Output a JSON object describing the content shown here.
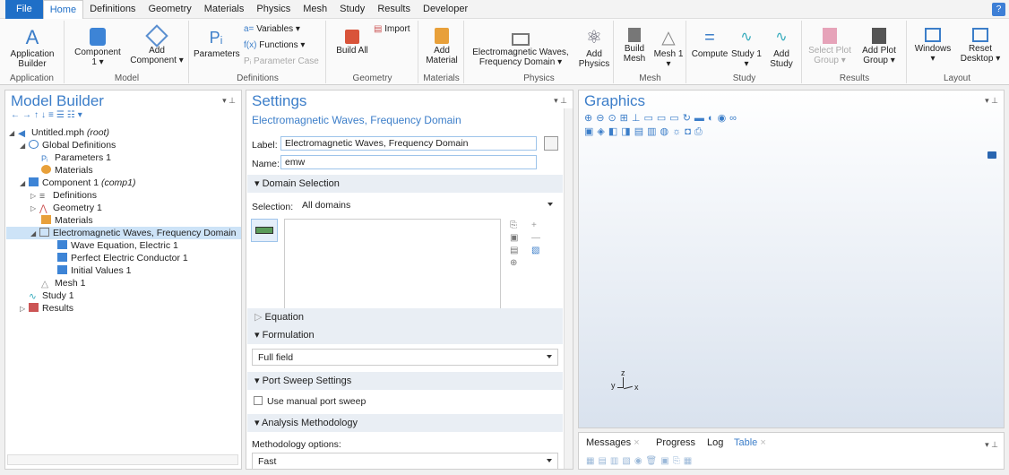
{
  "menubar": {
    "items": [
      "File",
      "Home",
      "Definitions",
      "Geometry",
      "Materials",
      "Physics",
      "Mesh",
      "Study",
      "Results",
      "Developer"
    ],
    "help": "?"
  },
  "ribbon": {
    "application": {
      "builder_label": "Application Builder",
      "group": "Application"
    },
    "model": {
      "component": "Component 1",
      "add_component": "Add Component",
      "group": "Model"
    },
    "definitions": {
      "parameters": "Parameters",
      "variables": "Variables",
      "functions": "Functions",
      "parameter_case": "Parameter Case",
      "group": "Definitions"
    },
    "geometry": {
      "build_all": "Build All",
      "import": "Import",
      "group": "Geometry"
    },
    "materials": {
      "add_material": "Add Material",
      "group": "Materials"
    },
    "physics": {
      "emw": "Electromagnetic Waves, Frequency Domain",
      "add_physics": "Add Physics",
      "group": "Physics"
    },
    "mesh": {
      "build_mesh": "Build Mesh",
      "mesh1": "Mesh 1",
      "group": "Mesh"
    },
    "study": {
      "compute": "Compute",
      "study1": "Study 1",
      "add_study": "Add Study",
      "group": "Study"
    },
    "results": {
      "select_plot_group": "Select Plot Group",
      "add_plot_group": "Add Plot Group",
      "group": "Results"
    },
    "layout": {
      "windows": "Windows",
      "reset_desktop": "Reset Desktop",
      "group": "Layout"
    }
  },
  "model_builder": {
    "title": "Model Builder",
    "tree": [
      {
        "label": "Untitled.mph",
        "suffix": "(root)"
      },
      {
        "label": "Global Definitions"
      },
      {
        "label": "Parameters 1"
      },
      {
        "label": "Materials"
      },
      {
        "label": "Component 1",
        "suffix": "(comp1)"
      },
      {
        "label": "Definitions"
      },
      {
        "label": "Geometry 1"
      },
      {
        "label": "Materials"
      },
      {
        "label": "Electromagnetic Waves, Frequency Domain"
      },
      {
        "label": "Wave Equation, Electric 1"
      },
      {
        "label": "Perfect Electric Conductor 1"
      },
      {
        "label": "Initial Values 1"
      },
      {
        "label": "Mesh 1"
      },
      {
        "label": "Study 1"
      },
      {
        "label": "Results"
      }
    ]
  },
  "settings": {
    "title": "Settings",
    "subtitle": "Electromagnetic Waves, Frequency Domain",
    "label_caption": "Label:",
    "label_value": "Electromagnetic Waves, Frequency Domain",
    "name_caption": "Name:",
    "name_value": "emw",
    "domain_selection": "Domain Selection",
    "selection_caption": "Selection:",
    "selection_value": "All domains",
    "equation": "Equation",
    "formulation": "Formulation",
    "formulation_value": "Full field",
    "port_sweep": "Port Sweep Settings",
    "manual_port_sweep": "Use manual port sweep",
    "analysis": "Analysis Methodology",
    "methodology_caption": "Methodology options:",
    "methodology_value": "Fast"
  },
  "graphics": {
    "title": "Graphics",
    "axis_z": "z",
    "axis_y": "y",
    "axis_x": "x"
  },
  "bottom": {
    "tabs": [
      "Messages",
      "Progress",
      "Log",
      "Table"
    ]
  },
  "colors": {
    "accent": "#1f6fc7",
    "title_blue": "#3c7ec9",
    "selection": "#cde3f7"
  }
}
